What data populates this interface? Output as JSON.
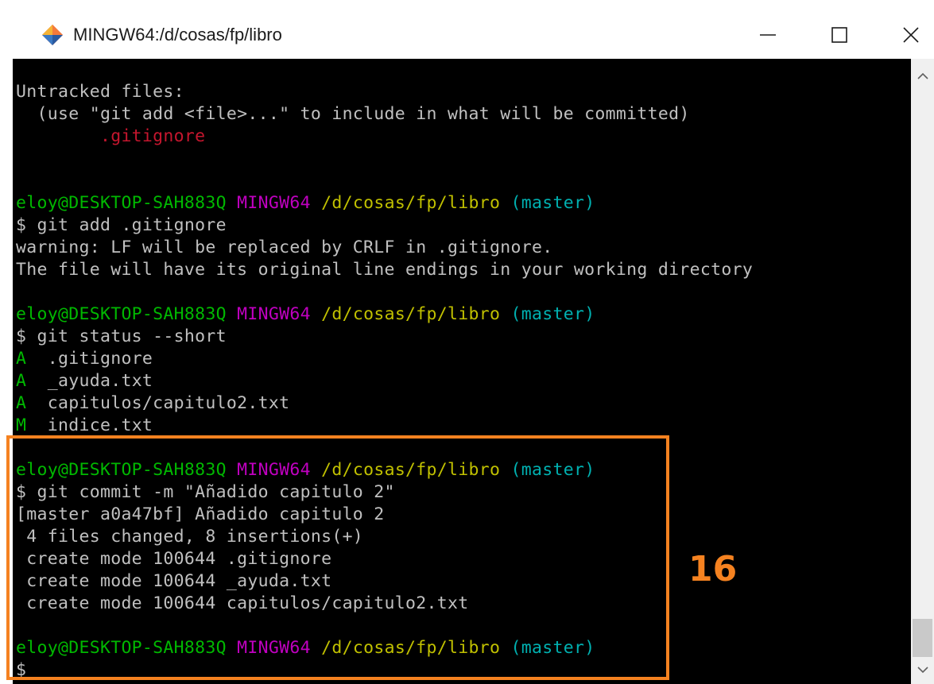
{
  "window": {
    "title": "MINGW64:/d/cosas/fp/libro",
    "app_icon": "git-diamond-icon",
    "controls": {
      "minimize": "minimize-icon",
      "maximize": "maximize-icon",
      "close": "close-icon"
    }
  },
  "colors": {
    "terminal_bg": "#000000",
    "text": "#c0c0c0",
    "red": "#c5162e",
    "green": "#00b800",
    "magenta": "#c000c0",
    "yellow": "#c0c000",
    "cyan": "#00b0b0",
    "annotation": "#f58220"
  },
  "terminal": {
    "lines": [
      [
        {
          "t": "Untracked files:",
          "c": "white"
        }
      ],
      [
        {
          "t": "  (use \"git add <file>...\" to include in what will be committed)",
          "c": "white"
        }
      ],
      [
        {
          "t": "        .gitignore",
          "c": "red"
        }
      ],
      [],
      [],
      [
        {
          "t": "eloy@DESKTOP-SAH883Q",
          "c": "green"
        },
        {
          "t": " ",
          "c": "white"
        },
        {
          "t": "MINGW64",
          "c": "magenta"
        },
        {
          "t": " ",
          "c": "white"
        },
        {
          "t": "/d/cosas/fp/libro",
          "c": "yellow"
        },
        {
          "t": " ",
          "c": "white"
        },
        {
          "t": "(master)",
          "c": "cyan"
        }
      ],
      [
        {
          "t": "$ git add .gitignore",
          "c": "white"
        }
      ],
      [
        {
          "t": "warning: LF will be replaced by CRLF in .gitignore.",
          "c": "white"
        }
      ],
      [
        {
          "t": "The file will have its original line endings in your working directory",
          "c": "white"
        }
      ],
      [],
      [
        {
          "t": "eloy@DESKTOP-SAH883Q",
          "c": "green"
        },
        {
          "t": " ",
          "c": "white"
        },
        {
          "t": "MINGW64",
          "c": "magenta"
        },
        {
          "t": " ",
          "c": "white"
        },
        {
          "t": "/d/cosas/fp/libro",
          "c": "yellow"
        },
        {
          "t": " ",
          "c": "white"
        },
        {
          "t": "(master)",
          "c": "cyan"
        }
      ],
      [
        {
          "t": "$ git status --short",
          "c": "white"
        }
      ],
      [
        {
          "t": "A",
          "c": "green"
        },
        {
          "t": "  .gitignore",
          "c": "white"
        }
      ],
      [
        {
          "t": "A",
          "c": "green"
        },
        {
          "t": "  _ayuda.txt",
          "c": "white"
        }
      ],
      [
        {
          "t": "A",
          "c": "green"
        },
        {
          "t": "  capitulos/capitulo2.txt",
          "c": "white"
        }
      ],
      [
        {
          "t": "M",
          "c": "green"
        },
        {
          "t": "  indice.txt",
          "c": "white"
        }
      ],
      [],
      [
        {
          "t": "eloy@DESKTOP-SAH883Q",
          "c": "green"
        },
        {
          "t": " ",
          "c": "white"
        },
        {
          "t": "MINGW64",
          "c": "magenta"
        },
        {
          "t": " ",
          "c": "white"
        },
        {
          "t": "/d/cosas/fp/libro",
          "c": "yellow"
        },
        {
          "t": " ",
          "c": "white"
        },
        {
          "t": "(master)",
          "c": "cyan"
        }
      ],
      [
        {
          "t": "$ git commit -m \"Añadido capitulo 2\"",
          "c": "white"
        }
      ],
      [
        {
          "t": "[master a0a47bf] Añadido capitulo 2",
          "c": "white"
        }
      ],
      [
        {
          "t": " 4 files changed, 8 insertions(+)",
          "c": "white"
        }
      ],
      [
        {
          "t": " create mode 100644 .gitignore",
          "c": "white"
        }
      ],
      [
        {
          "t": " create mode 100644 _ayuda.txt",
          "c": "white"
        }
      ],
      [
        {
          "t": " create mode 100644 capitulos/capitulo2.txt",
          "c": "white"
        }
      ],
      [],
      [
        {
          "t": "eloy@DESKTOP-SAH883Q",
          "c": "green"
        },
        {
          "t": " ",
          "c": "white"
        },
        {
          "t": "MINGW64",
          "c": "magenta"
        },
        {
          "t": " ",
          "c": "white"
        },
        {
          "t": "/d/cosas/fp/libro",
          "c": "yellow"
        },
        {
          "t": " ",
          "c": "white"
        },
        {
          "t": "(master)",
          "c": "cyan"
        }
      ],
      [
        {
          "t": "$",
          "c": "white"
        }
      ]
    ]
  },
  "annotation": {
    "step_number": "16"
  },
  "scrollbar": {
    "up_icon": "chevron-up-icon",
    "down_icon": "chevron-down-icon"
  }
}
